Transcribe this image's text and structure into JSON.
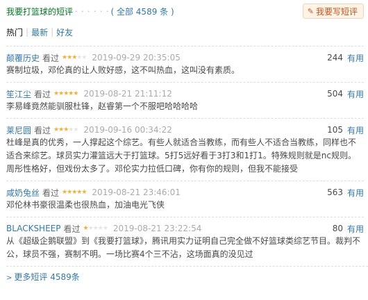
{
  "header": {
    "title": "我要打篮球的短评",
    "dots": "· · · · · ·",
    "count_label": "( 全部 4589 条 )",
    "write_button": "我要写短评",
    "write_icon": "pencil-icon"
  },
  "tabs": [
    {
      "label": "热门",
      "active": true
    },
    {
      "label": "最新",
      "active": false
    },
    {
      "label": "好友",
      "active": false
    }
  ],
  "comments": [
    {
      "user": "颠覆历史",
      "seen": "看过",
      "rating": 3,
      "time": "2019-09-29 20:35:05",
      "votes": "244",
      "useful": "有用",
      "text": "赛制垃圾，邓伦真的让人败好感，这不叫热血，这叫没有素质。"
    },
    {
      "user": "笙江尘",
      "seen": "看过",
      "rating": 5,
      "time": "2019-08-21 21:11:12",
      "votes": "504",
      "useful": "有用",
      "text": "李易峰竟然能驯服杜锋，赵睿第一个不服吧哈哈哈哈"
    },
    {
      "user": "莱尼圆",
      "seen": "看过",
      "rating": 3,
      "time": "2019-09-16 00:34:22",
      "votes": "105",
      "useful": "有用",
      "text": "杜峰是真的优秀，一人撑起这个综艺。有些人就适合当教练，而有些人不适合当教练，同样也不适合来综艺。球员实力灌篮远大于打篮球。5打5远好看于3打3和1打1。特殊规则就是nc规则。周彤性格好，但戏份太多了。邓伦实力拉低口碑，你有你的规则，但我不能接受"
    },
    {
      "user": "咸奶兔丝",
      "seen": "看过",
      "rating": 5,
      "time": "2019-08-21 23:46:01",
      "votes": "563",
      "useful": "有用",
      "text": "邓伦林书豪很温柔也很热血，加油电光飞侠"
    },
    {
      "user": "BLACKSHEEP",
      "seen": "看过",
      "rating": 1,
      "time": "2019-08-21 23:22:54",
      "votes": "80",
      "useful": "有用",
      "text": "从《超级企鹅联盟》到《我要打篮球》，腾讯用实力证明自己完全做不好篮球类综艺节目。裁判不公，球员不强，赛制不明。一场比赛4个三不沾，这场面真的没见过"
    }
  ],
  "more_link": "更多短评 4589条",
  "colors": {
    "green": "#007722",
    "link": "#37a",
    "star": "#ffac2d",
    "button_bg": "#fff3e6"
  }
}
